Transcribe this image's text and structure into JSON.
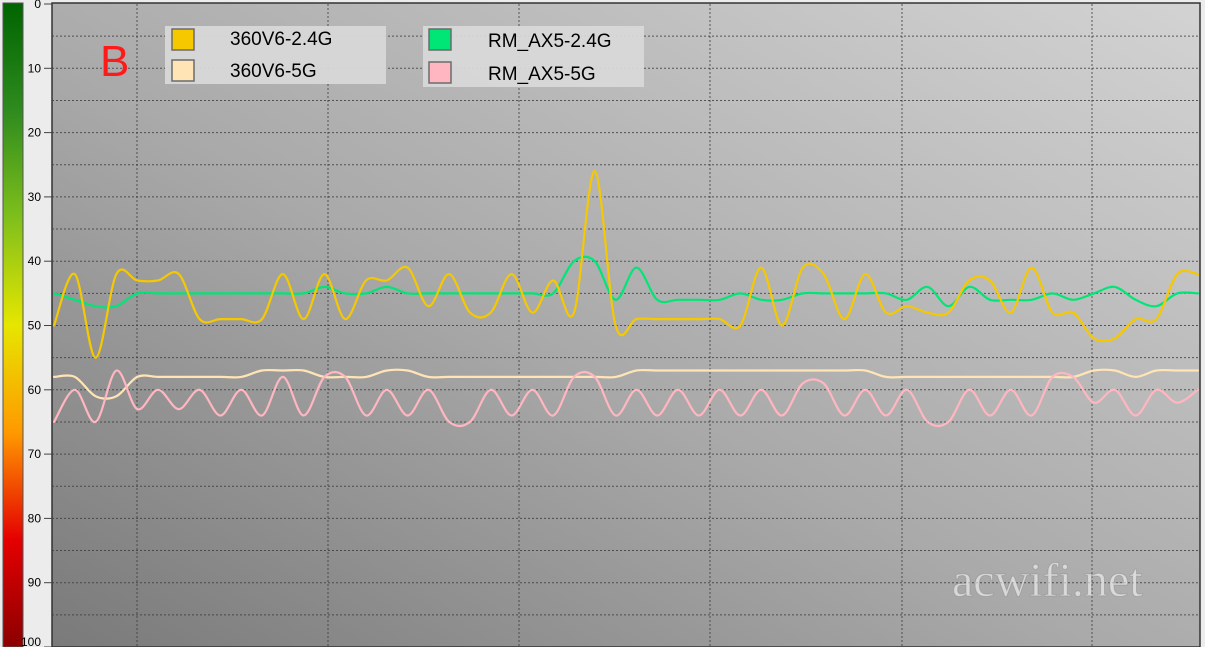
{
  "chart_data": {
    "type": "line",
    "title": "",
    "xlabel": "",
    "ylabel": "",
    "ylim": [
      0,
      100
    ],
    "y_inverted": true,
    "y_ticks": [
      0,
      10,
      20,
      30,
      40,
      50,
      60,
      70,
      80,
      90,
      100
    ],
    "grid": true,
    "legend_position": "top-left",
    "badge": "B",
    "watermark": "acwifi.net",
    "colors": {
      "scale_gradient": [
        "#006400",
        "#2e8b1e",
        "#7fbf1c",
        "#e6e600",
        "#ff9900",
        "#e50000",
        "#8b0000"
      ]
    },
    "series": [
      {
        "name": "360V6-2.4G",
        "color": "#f5c800",
        "values": [
          50,
          42,
          55,
          42,
          43,
          43,
          42,
          49,
          49,
          49,
          49,
          42,
          49,
          42,
          49,
          43,
          43,
          41,
          47,
          42,
          48,
          48,
          42,
          48,
          43,
          48,
          26,
          50,
          49,
          49,
          49,
          49,
          49,
          50,
          41,
          50,
          41,
          42,
          49,
          42,
          48,
          47,
          48,
          48,
          43,
          43,
          48,
          41,
          48,
          48,
          52,
          52,
          49,
          49,
          42,
          42
        ]
      },
      {
        "name": "360V6-5G",
        "color": "#ffe4b5",
        "values": [
          58,
          58,
          61,
          61,
          58,
          58,
          58,
          58,
          58,
          58,
          57,
          57,
          57,
          58,
          58,
          58,
          57,
          57,
          58,
          58,
          58,
          58,
          58,
          58,
          58,
          58,
          58,
          58,
          57,
          57,
          57,
          57,
          57,
          57,
          57,
          57,
          57,
          57,
          57,
          57,
          58,
          58,
          58,
          58,
          58,
          58,
          58,
          58,
          58,
          58,
          57,
          57,
          58,
          57,
          57,
          57
        ]
      },
      {
        "name": "RM_AX5-2.4G",
        "color": "#00e676",
        "values": [
          45,
          46,
          47,
          47,
          45,
          45,
          45,
          45,
          45,
          45,
          45,
          45,
          45,
          44,
          45,
          45,
          44,
          45,
          45,
          45,
          45,
          45,
          45,
          45,
          45,
          40,
          40,
          46,
          41,
          46,
          46,
          46,
          46,
          45,
          46,
          46,
          45,
          45,
          45,
          45,
          45,
          46,
          44,
          47,
          44,
          46,
          46,
          46,
          45,
          46,
          45,
          44,
          46,
          47,
          45,
          45
        ]
      },
      {
        "name": "RM_AX5-5G",
        "color": "#ffb6c1",
        "values": [
          65,
          60,
          65,
          57,
          63,
          60,
          63,
          60,
          64,
          60,
          64,
          58,
          64,
          58,
          58,
          64,
          60,
          64,
          60,
          65,
          65,
          60,
          64,
          60,
          64,
          58,
          58,
          64,
          60,
          64,
          60,
          64,
          60,
          64,
          60,
          64,
          59,
          59,
          64,
          60,
          64,
          60,
          65,
          65,
          60,
          64,
          60,
          64,
          58,
          58,
          62,
          60,
          64,
          60,
          62,
          60
        ]
      }
    ]
  }
}
